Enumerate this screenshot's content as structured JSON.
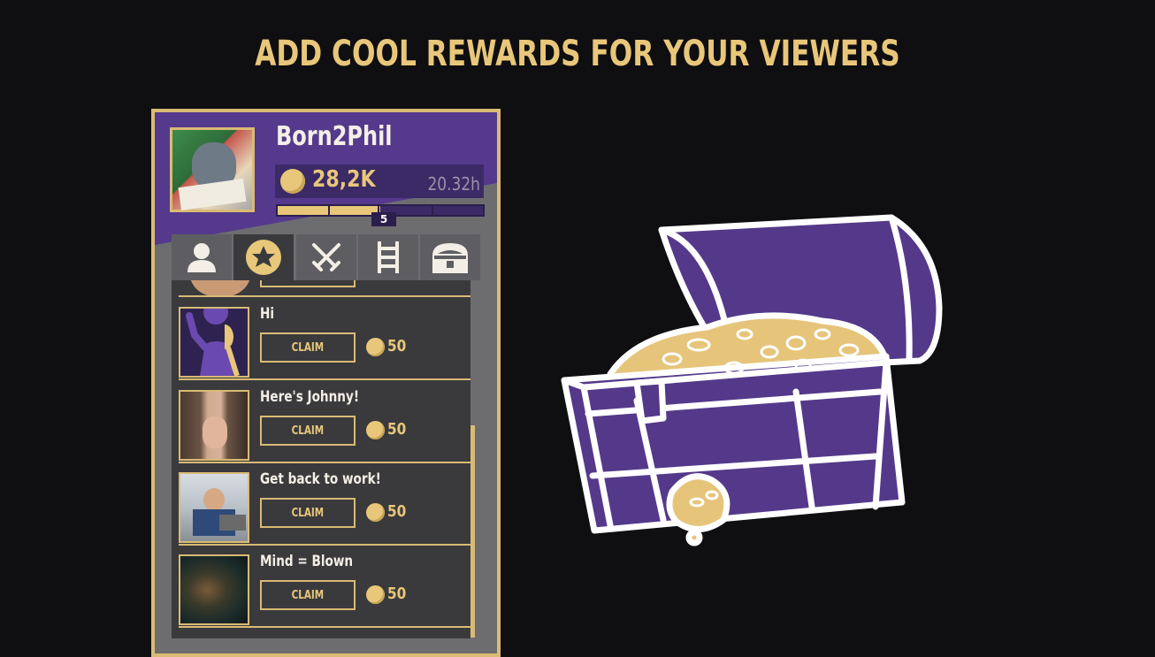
{
  "headline": "ADD COOL REWARDS FOR YOUR VIEWERS",
  "profile": {
    "username": "Born2Phil",
    "coins": "28,2K",
    "watch_time": "20.32h",
    "level": "5",
    "level_progress": 0.5
  },
  "tabs": [
    {
      "name": "profile",
      "icon": "user-icon",
      "active": false
    },
    {
      "name": "rewards",
      "icon": "star-icon",
      "active": true
    },
    {
      "name": "battles",
      "icon": "crossed-swords-icon",
      "active": false
    },
    {
      "name": "leaderboard",
      "icon": "ladder-icon",
      "active": false
    },
    {
      "name": "chest",
      "icon": "chest-icon",
      "active": false
    }
  ],
  "rewards": [
    {
      "name": "Hi",
      "claim_label": "CLAIM",
      "cost": "50",
      "thumb": "waving-figure"
    },
    {
      "name": "Here's Johnny!",
      "claim_label": "CLAIM",
      "cost": "50",
      "thumb": "johnny"
    },
    {
      "name": "Get back to work!",
      "claim_label": "CLAIM",
      "cost": "50",
      "thumb": "office"
    },
    {
      "name": "Mind = Blown",
      "claim_label": "CLAIM",
      "cost": "50",
      "thumb": "galaxy"
    }
  ],
  "colors": {
    "gold": "#e8c77a",
    "purple": "#55398d",
    "background": "#0f0e11"
  }
}
